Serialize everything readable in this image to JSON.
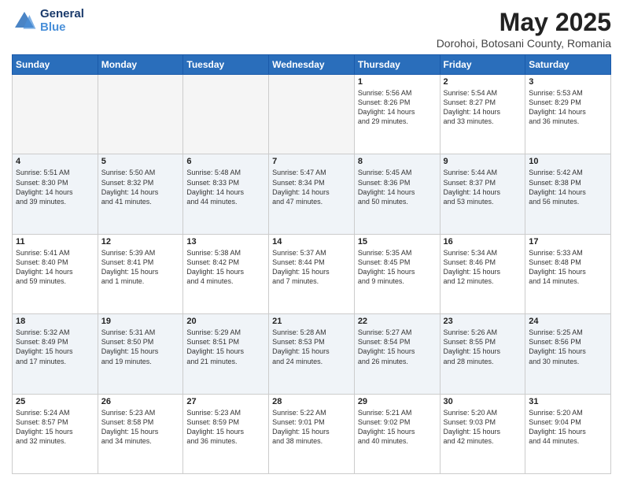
{
  "header": {
    "logo_line1": "General",
    "logo_line2": "Blue",
    "title": "May 2025",
    "subtitle": "Dorohoi, Botosani County, Romania"
  },
  "weekdays": [
    "Sunday",
    "Monday",
    "Tuesday",
    "Wednesday",
    "Thursday",
    "Friday",
    "Saturday"
  ],
  "weeks": [
    [
      {
        "day": "",
        "info": ""
      },
      {
        "day": "",
        "info": ""
      },
      {
        "day": "",
        "info": ""
      },
      {
        "day": "",
        "info": ""
      },
      {
        "day": "1",
        "info": "Sunrise: 5:56 AM\nSunset: 8:26 PM\nDaylight: 14 hours\nand 29 minutes."
      },
      {
        "day": "2",
        "info": "Sunrise: 5:54 AM\nSunset: 8:27 PM\nDaylight: 14 hours\nand 33 minutes."
      },
      {
        "day": "3",
        "info": "Sunrise: 5:53 AM\nSunset: 8:29 PM\nDaylight: 14 hours\nand 36 minutes."
      }
    ],
    [
      {
        "day": "4",
        "info": "Sunrise: 5:51 AM\nSunset: 8:30 PM\nDaylight: 14 hours\nand 39 minutes."
      },
      {
        "day": "5",
        "info": "Sunrise: 5:50 AM\nSunset: 8:32 PM\nDaylight: 14 hours\nand 41 minutes."
      },
      {
        "day": "6",
        "info": "Sunrise: 5:48 AM\nSunset: 8:33 PM\nDaylight: 14 hours\nand 44 minutes."
      },
      {
        "day": "7",
        "info": "Sunrise: 5:47 AM\nSunset: 8:34 PM\nDaylight: 14 hours\nand 47 minutes."
      },
      {
        "day": "8",
        "info": "Sunrise: 5:45 AM\nSunset: 8:36 PM\nDaylight: 14 hours\nand 50 minutes."
      },
      {
        "day": "9",
        "info": "Sunrise: 5:44 AM\nSunset: 8:37 PM\nDaylight: 14 hours\nand 53 minutes."
      },
      {
        "day": "10",
        "info": "Sunrise: 5:42 AM\nSunset: 8:38 PM\nDaylight: 14 hours\nand 56 minutes."
      }
    ],
    [
      {
        "day": "11",
        "info": "Sunrise: 5:41 AM\nSunset: 8:40 PM\nDaylight: 14 hours\nand 59 minutes."
      },
      {
        "day": "12",
        "info": "Sunrise: 5:39 AM\nSunset: 8:41 PM\nDaylight: 15 hours\nand 1 minute."
      },
      {
        "day": "13",
        "info": "Sunrise: 5:38 AM\nSunset: 8:42 PM\nDaylight: 15 hours\nand 4 minutes."
      },
      {
        "day": "14",
        "info": "Sunrise: 5:37 AM\nSunset: 8:44 PM\nDaylight: 15 hours\nand 7 minutes."
      },
      {
        "day": "15",
        "info": "Sunrise: 5:35 AM\nSunset: 8:45 PM\nDaylight: 15 hours\nand 9 minutes."
      },
      {
        "day": "16",
        "info": "Sunrise: 5:34 AM\nSunset: 8:46 PM\nDaylight: 15 hours\nand 12 minutes."
      },
      {
        "day": "17",
        "info": "Sunrise: 5:33 AM\nSunset: 8:48 PM\nDaylight: 15 hours\nand 14 minutes."
      }
    ],
    [
      {
        "day": "18",
        "info": "Sunrise: 5:32 AM\nSunset: 8:49 PM\nDaylight: 15 hours\nand 17 minutes."
      },
      {
        "day": "19",
        "info": "Sunrise: 5:31 AM\nSunset: 8:50 PM\nDaylight: 15 hours\nand 19 minutes."
      },
      {
        "day": "20",
        "info": "Sunrise: 5:29 AM\nSunset: 8:51 PM\nDaylight: 15 hours\nand 21 minutes."
      },
      {
        "day": "21",
        "info": "Sunrise: 5:28 AM\nSunset: 8:53 PM\nDaylight: 15 hours\nand 24 minutes."
      },
      {
        "day": "22",
        "info": "Sunrise: 5:27 AM\nSunset: 8:54 PM\nDaylight: 15 hours\nand 26 minutes."
      },
      {
        "day": "23",
        "info": "Sunrise: 5:26 AM\nSunset: 8:55 PM\nDaylight: 15 hours\nand 28 minutes."
      },
      {
        "day": "24",
        "info": "Sunrise: 5:25 AM\nSunset: 8:56 PM\nDaylight: 15 hours\nand 30 minutes."
      }
    ],
    [
      {
        "day": "25",
        "info": "Sunrise: 5:24 AM\nSunset: 8:57 PM\nDaylight: 15 hours\nand 32 minutes."
      },
      {
        "day": "26",
        "info": "Sunrise: 5:23 AM\nSunset: 8:58 PM\nDaylight: 15 hours\nand 34 minutes."
      },
      {
        "day": "27",
        "info": "Sunrise: 5:23 AM\nSunset: 8:59 PM\nDaylight: 15 hours\nand 36 minutes."
      },
      {
        "day": "28",
        "info": "Sunrise: 5:22 AM\nSunset: 9:01 PM\nDaylight: 15 hours\nand 38 minutes."
      },
      {
        "day": "29",
        "info": "Sunrise: 5:21 AM\nSunset: 9:02 PM\nDaylight: 15 hours\nand 40 minutes."
      },
      {
        "day": "30",
        "info": "Sunrise: 5:20 AM\nSunset: 9:03 PM\nDaylight: 15 hours\nand 42 minutes."
      },
      {
        "day": "31",
        "info": "Sunrise: 5:20 AM\nSunset: 9:04 PM\nDaylight: 15 hours\nand 44 minutes."
      }
    ]
  ]
}
